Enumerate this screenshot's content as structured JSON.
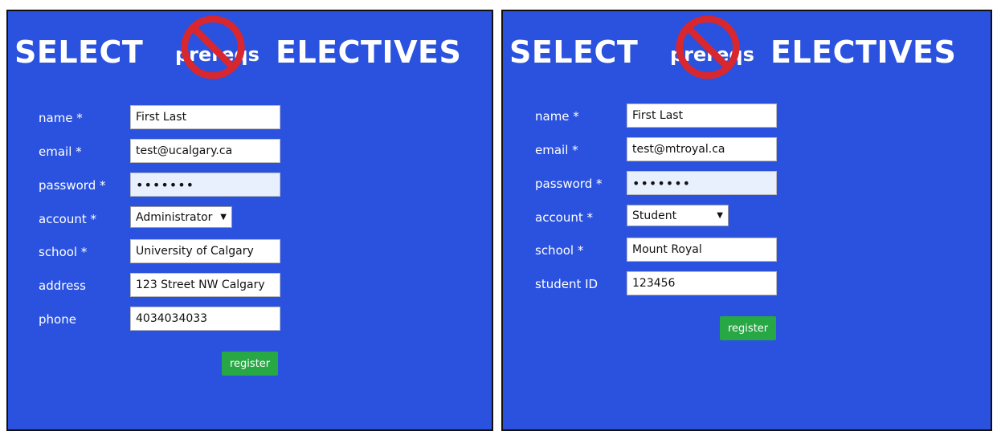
{
  "left": {
    "logo": {
      "select": "SELECT",
      "prereqs": "prereqs",
      "electives": "ELECTIVES"
    },
    "fields": {
      "name": {
        "label": "name *",
        "value": "First Last"
      },
      "email": {
        "label": "email *",
        "value": "test@ucalgary.ca"
      },
      "password": {
        "label": "password *",
        "value": "•••••••"
      },
      "account": {
        "label": "account *",
        "value": "Administrator"
      },
      "school": {
        "label": "school *",
        "value": "University of Calgary"
      },
      "address": {
        "label": "address",
        "value": "123 Street NW Calgary"
      },
      "phone": {
        "label": "phone",
        "value": "4034034033"
      }
    },
    "register_label": "register"
  },
  "right": {
    "logo": {
      "select": "SELECT",
      "prereqs": "prereqs",
      "electives": "ELECTIVES"
    },
    "fields": {
      "name": {
        "label": "name *",
        "value": "First Last"
      },
      "email": {
        "label": "email *",
        "value": "test@mtroyal.ca"
      },
      "password": {
        "label": "password *",
        "value": "•••••••"
      },
      "account": {
        "label": "account *",
        "value": "Student"
      },
      "school": {
        "label": "school *",
        "value": "Mount Royal"
      },
      "student_id": {
        "label": "student ID",
        "value": "123456"
      }
    },
    "register_label": "register"
  },
  "icons": {
    "logo_prohibition": "no-sign-icon",
    "select_arrow": "dropdown-arrow-icon"
  },
  "colors": {
    "background": "#2a52df",
    "button": "#28a745",
    "prohibition": "#d8272e"
  }
}
